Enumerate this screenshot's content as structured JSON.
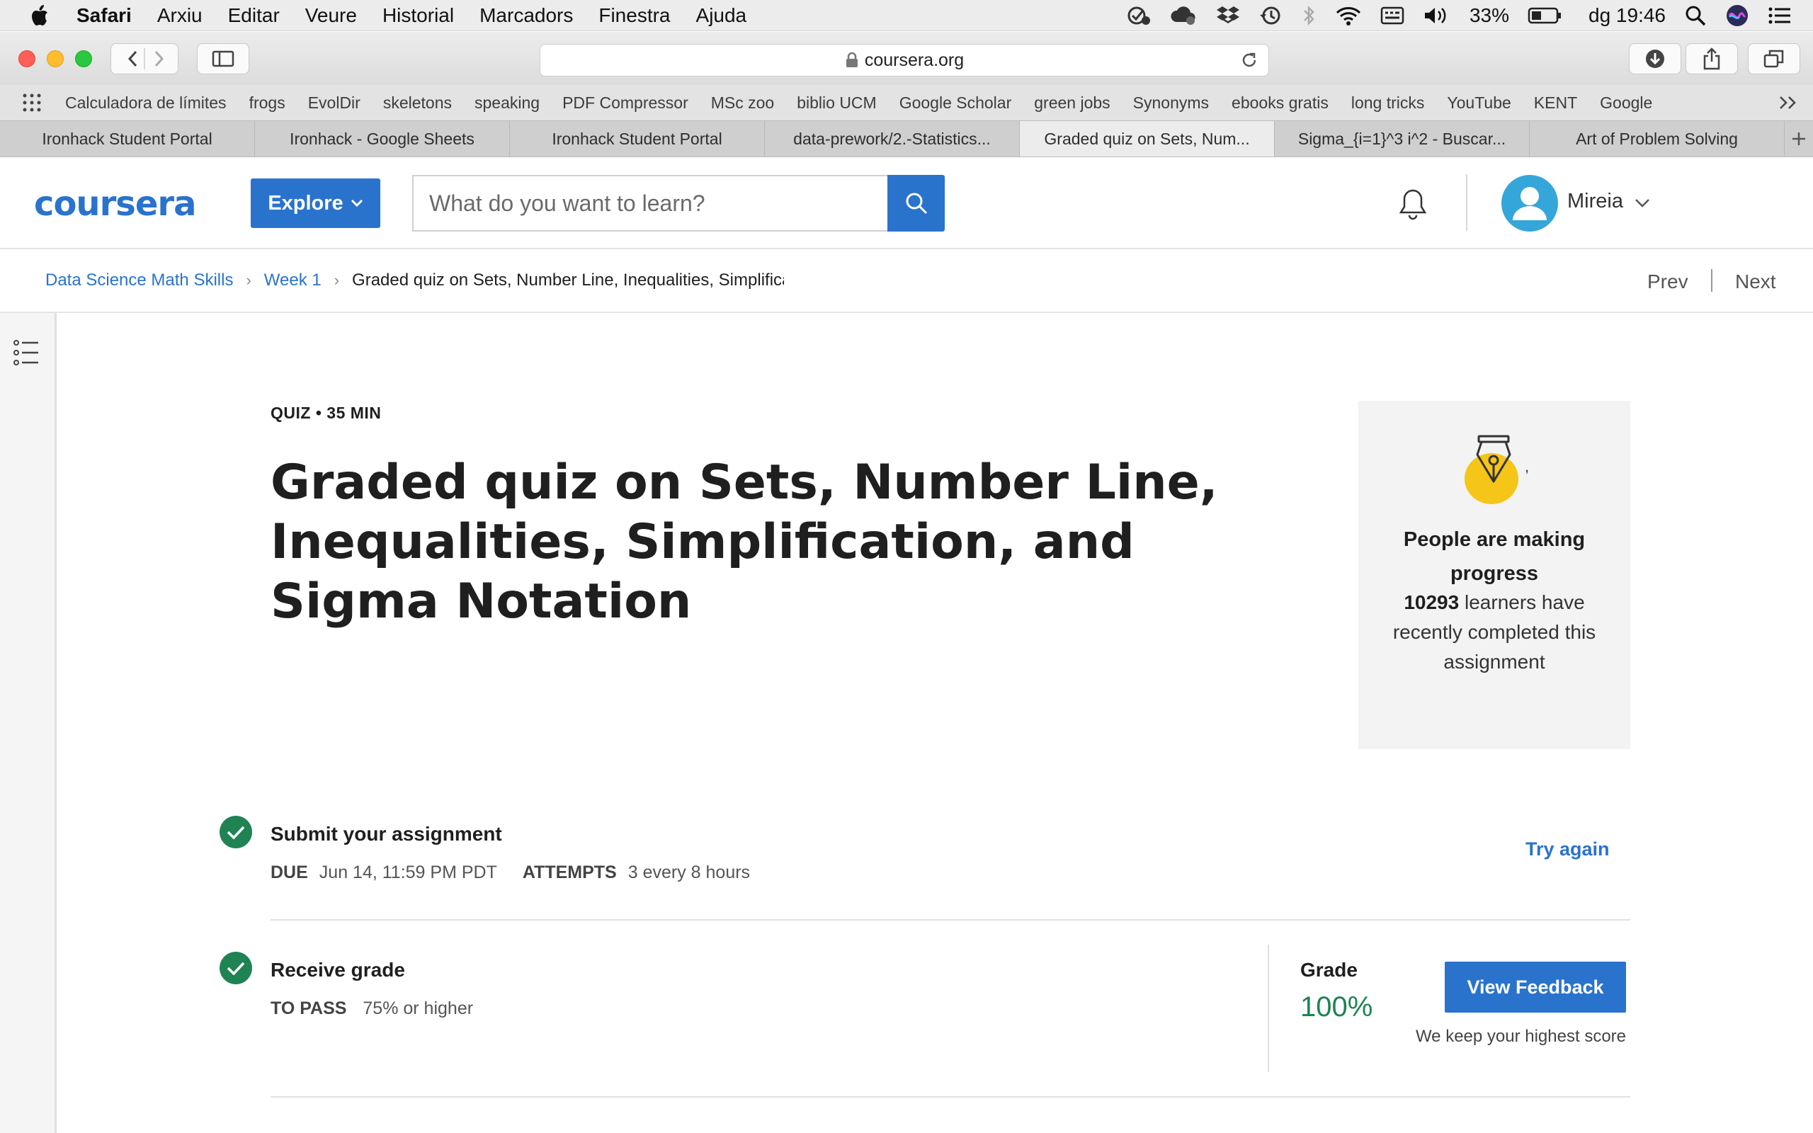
{
  "menubar": {
    "app": "Safari",
    "items": [
      "Arxiu",
      "Editar",
      "Veure",
      "Historial",
      "Marcadors",
      "Finestra",
      "Ajuda"
    ],
    "battery": "33%",
    "clock": "dg 19:46"
  },
  "browser": {
    "url": "coursera.org",
    "bookmarks": [
      "Calculadora de límites",
      "frogs",
      "EvolDir",
      "skeletons",
      "speaking",
      "PDF Compressor",
      "MSc zoo",
      "biblio UCM",
      "Google Scholar",
      "green jobs",
      "Synonyms",
      "ebooks gratis",
      "long tricks",
      "YouTube",
      "KENT",
      "Google"
    ],
    "tabs": [
      "Ironhack Student Portal",
      "Ironhack - Google Sheets",
      "Ironhack Student Portal",
      "data-prework/2.-Statistics...",
      "Graded quiz on Sets, Num...",
      "Sigma_{i=1}^3 i^2 - Buscar...",
      "Art of Problem Solving"
    ],
    "active_tab_index": 4
  },
  "header": {
    "logo": "coursera",
    "explore_label": "Explore",
    "search_placeholder": "What do you want to learn?",
    "user_name": "Mireia"
  },
  "breadcrumb": {
    "course": "Data Science Math Skills",
    "week": "Week 1",
    "current": "Graded quiz on Sets, Number Line, Inequalities, Simplification, and Sigma Notation",
    "prev": "Prev",
    "next": "Next"
  },
  "quiz": {
    "meta": "QUIZ • 35 MIN",
    "title": "Graded quiz on Sets, Number Line, Inequalities, Simplification, and Sigma Notation"
  },
  "progress_card": {
    "heading": "People are making progress",
    "count": "10293",
    "text": " learners have recently completed this assignment"
  },
  "submit": {
    "title": "Submit your assignment",
    "due_label": "DUE",
    "due_value": "Jun 14, 11:59 PM PDT",
    "attempts_label": "ATTEMPTS",
    "attempts_value": "3 every 8 hours",
    "try_again": "Try again"
  },
  "grade": {
    "title": "Receive grade",
    "pass_label": "TO PASS",
    "pass_value": "75% or higher",
    "grade_label": "Grade",
    "grade_value": "100%",
    "view_feedback": "View Feedback",
    "keep_note": "We keep your highest score"
  },
  "colors": {
    "brand_blue": "#2a73cc",
    "success_green": "#1f8354",
    "pen_yellow": "#f5c518"
  }
}
